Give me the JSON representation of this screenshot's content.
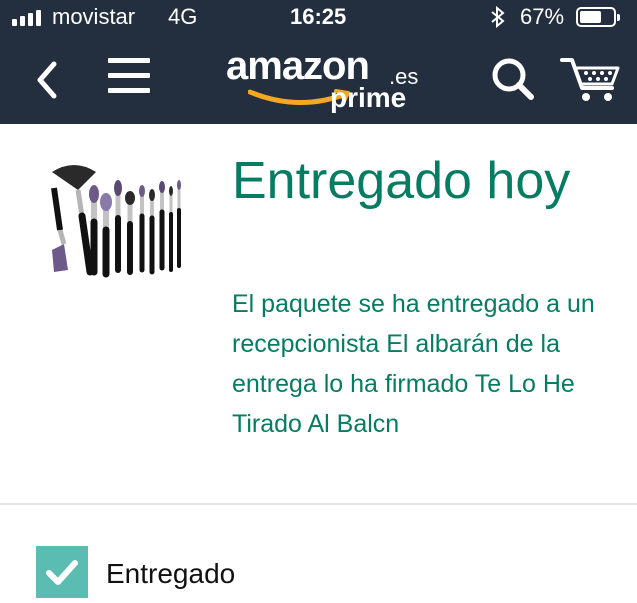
{
  "status_bar": {
    "carrier": "movistar",
    "network": "4G",
    "time": "16:25",
    "battery_percent": "67%",
    "battery_level": 0.67
  },
  "header": {
    "back_icon": "chevron-left-icon",
    "menu_icon": "hamburger-menu-icon",
    "logo_word": "amazon",
    "logo_tld": ".es",
    "logo_prime": "prime",
    "search_icon": "search-icon",
    "cart_icon": "cart-icon",
    "colors": {
      "bar": "#232f3e",
      "smile": "#f5a623"
    }
  },
  "delivery": {
    "title": "Entregado hoy",
    "description": "El paquete se ha entregado a un recepcionista El albarán de la entrega lo ha firmado Te Lo He Tirado Al Balcn",
    "color": "#067d62"
  },
  "progress": {
    "step_label": "Entregado",
    "checked": true,
    "check_color": "#5bbcb2"
  }
}
